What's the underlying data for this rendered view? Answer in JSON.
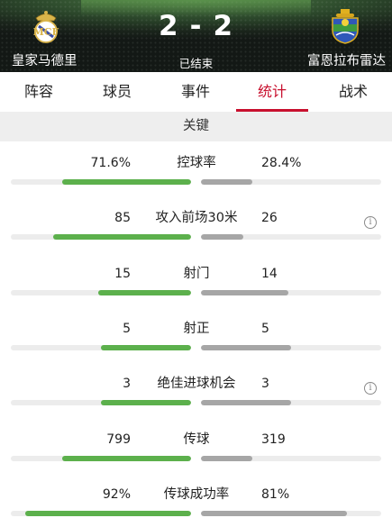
{
  "header": {
    "home_team": "皇家马德里",
    "away_team": "富恩拉布雷达",
    "home_score": "2",
    "separator": "-",
    "away_score": "2",
    "status": "已结束",
    "home_crest_icon": "real-madrid-crest-icon",
    "away_crest_icon": "fuenlabrada-crest-icon"
  },
  "tabs": [
    {
      "label": "阵容",
      "active": false
    },
    {
      "label": "球员",
      "active": false
    },
    {
      "label": "事件",
      "active": false
    },
    {
      "label": "统计",
      "active": true
    },
    {
      "label": "战术",
      "active": false
    }
  ],
  "section": {
    "title": "关键"
  },
  "colors": {
    "accent": "#c8102e",
    "lead_bar": "#5cb04c",
    "trail_bar": "#a6a6a6",
    "track": "#ececec"
  },
  "stats": [
    {
      "label": "控球率",
      "home": "71.6%",
      "away": "28.4%",
      "home_fraction": 0.716,
      "away_fraction": 0.284,
      "info": false
    },
    {
      "label": "攻入前场30米",
      "home": "85",
      "away": "26",
      "home_fraction": 0.766,
      "away_fraction": 0.234,
      "info": true
    },
    {
      "label": "射门",
      "home": "15",
      "away": "14",
      "home_fraction": 0.517,
      "away_fraction": 0.483,
      "info": false
    },
    {
      "label": "射正",
      "home": "5",
      "away": "5",
      "home_fraction": 0.5,
      "away_fraction": 0.5,
      "info": false
    },
    {
      "label": "绝佳进球机会",
      "home": "3",
      "away": "3",
      "home_fraction": 0.5,
      "away_fraction": 0.5,
      "info": true
    },
    {
      "label": "传球",
      "home": "799",
      "away": "319",
      "home_fraction": 0.715,
      "away_fraction": 0.285,
      "info": false
    },
    {
      "label": "传球成功率",
      "home": "92%",
      "away": "81%",
      "home_fraction": 0.92,
      "away_fraction": 0.81,
      "info": false
    }
  ]
}
